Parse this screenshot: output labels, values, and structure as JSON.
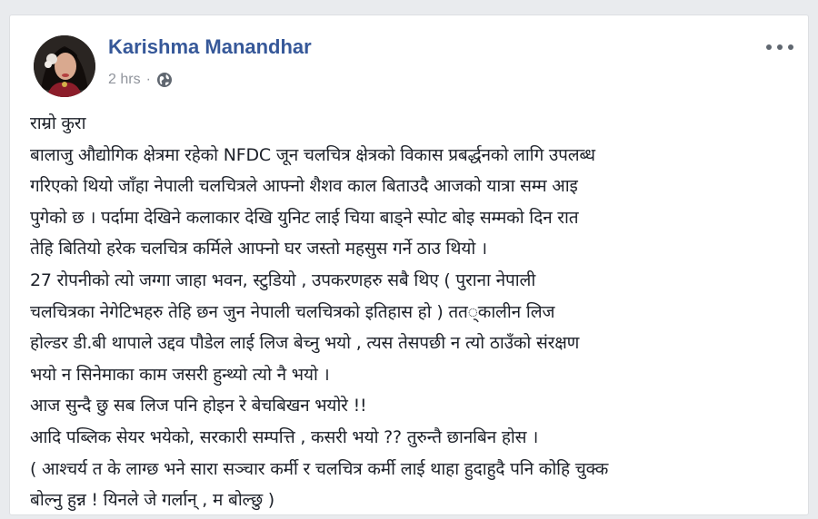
{
  "post": {
    "author": "Karishma Manandhar",
    "time": "2 hrs",
    "separator": "·",
    "lines": [
      "राम्रो कुरा",
      "बालाजु औद्योगिक क्षेत्रमा रहेको NFDC जून चलचित्र क्षेत्रको विकास प्रबर्द्धनको लागि उपलब्ध",
      "गरिएको थियो जाँहा नेपाली चलचित्रले आफ्नो शैशव काल बिताउदै आजको यात्रा सम्म आइ",
      "पुगेको छ । पर्दामा देखिने कलाकार देखि युनिट लाई चिया बाड्ने स्पोट बोइ सम्मको दिन रात",
      "तेहि बितियो हरेक चलचित्र कर्मिले आफ्नो घर जस्तो महसुस गर्ने ठाउ थियो ।",
      "27 रोपनीको त्यो जग्गा जाहा भवन, स्टुडियो , उपकरणहरु सबै थिए ( पुराना नेपाली",
      "चलचित्रका नेगेटिभहरु तेहि छन जुन नेपाली चलचित्रको इतिहास हो ) तत◌्कालीन लिज",
      "होल्डर डी.बी थापाले उद्दव पौडेल लाई लिज बेच्नु भयो , त्यस तेसपछी न त्यो ठाउँको संरक्षण",
      "भयो न सिनेमाका काम जसरी हुन्थ्यो त्यो नै भयो ।",
      "आज सुन्दै छु सब लिज पनि होइन रे बेचबिखन भयोरे !!",
      "आदि पब्लिक सेयर भयेको, सरकारी सम्पत्ति , कसरी भयो ?? तुरुन्तै छानबिन होस ।",
      "( आश्चर्य त के लाग्छ भने सारा सञ्चार कर्मी र चलचित्र कर्मी लाई थाहा हुदाहुदै पनि कोहि चुक्क",
      "बोल्नु हुन्न ! यिनले जे गर्लान् , म बोल्छु )"
    ]
  },
  "icons": {
    "privacy": "globe-icon",
    "menu": "more-options-icon"
  },
  "colors": {
    "author": "#365899",
    "meta": "#90949c",
    "text": "#1d2129",
    "background": "#e9ebee"
  }
}
